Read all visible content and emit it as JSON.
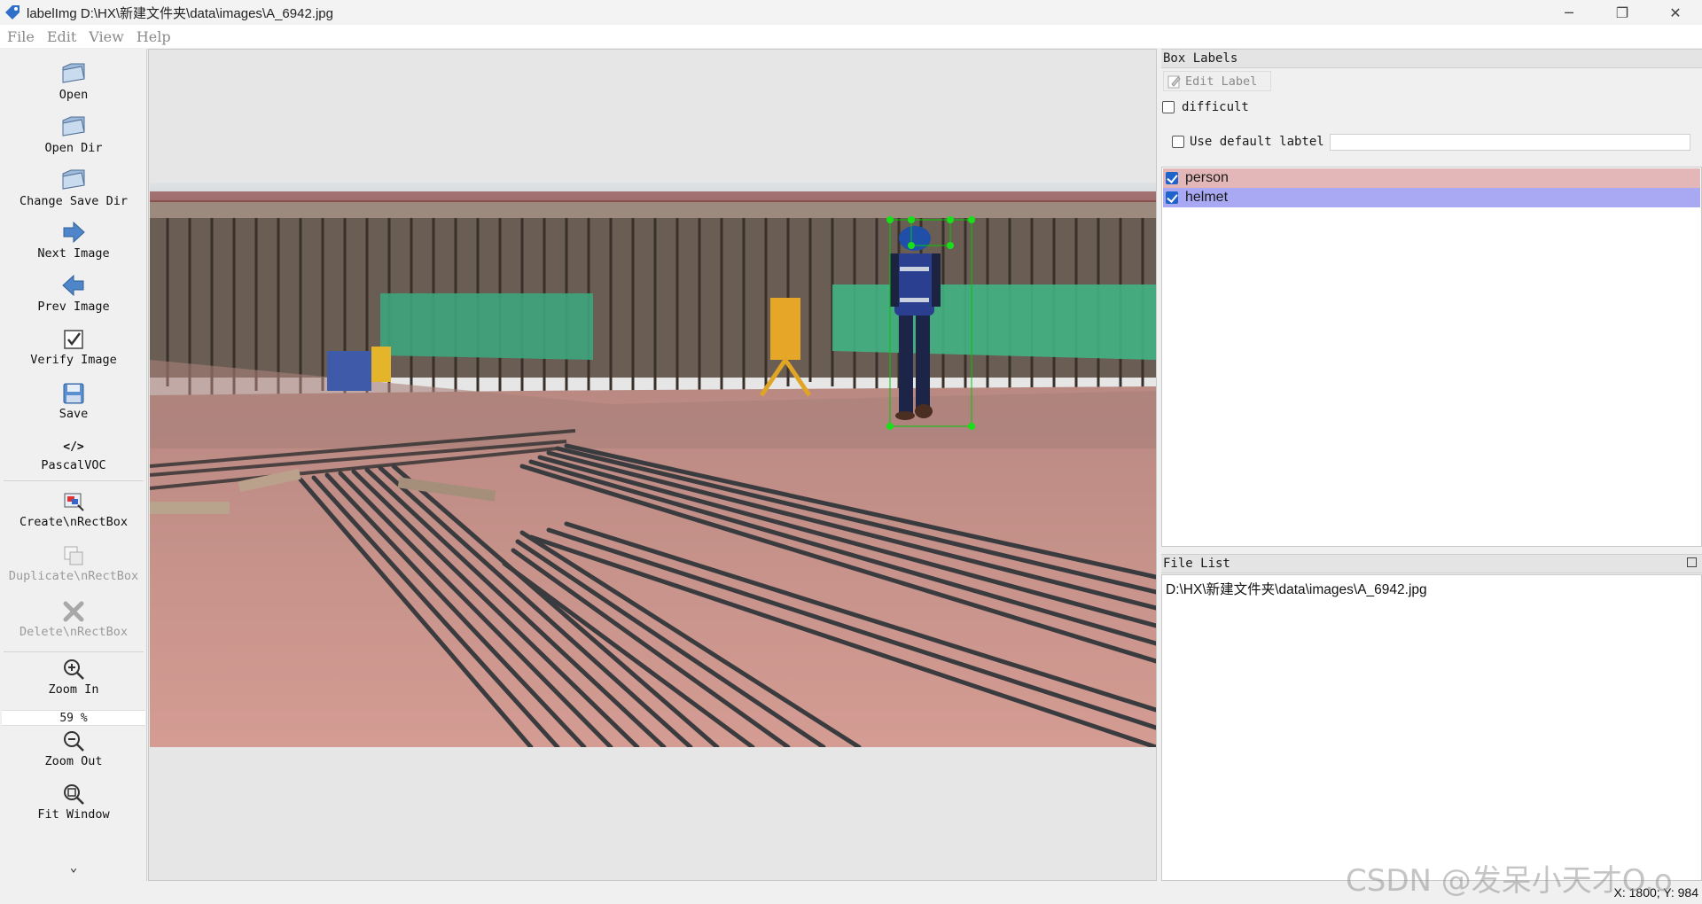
{
  "window": {
    "title": "labelImg D:\\HX\\新建文件夹\\data\\images\\A_6942.jpg",
    "controls": [
      "─",
      "❐",
      "✕"
    ]
  },
  "menu": [
    "File",
    "Edit",
    "View",
    "Help"
  ],
  "toolbar": {
    "open": "Open",
    "open_dir": "Open Dir",
    "change_save_dir": "Change Save Dir",
    "next_image": "Next Image",
    "prev_image": "Prev Image",
    "verify_image": "Verify Image",
    "save": "Save",
    "format": "PascalVOC",
    "format_icon": "</>",
    "create_rectbox": "Create\\nRectBox",
    "duplicate_rectbox": "Duplicate\\nRectBox",
    "delete_rectbox": "Delete\\nRectBox",
    "zoom_in": "Zoom In",
    "zoom_value": "59 %",
    "zoom_out": "Zoom Out",
    "fit_window": "Fit Window",
    "more_icon": "⌄"
  },
  "box_labels": {
    "header": "Box Labels",
    "edit_label": "Edit Label",
    "difficult": "difficult",
    "use_default_label": "Use default labtel",
    "default_label_value": "",
    "labels": [
      {
        "name": "person",
        "checked": true,
        "color": "#e3b7b7"
      },
      {
        "name": "helmet",
        "checked": true,
        "color": "#a9a9f3"
      }
    ]
  },
  "file_list": {
    "header": "File List",
    "files": [
      "D:\\HX\\新建文件夹\\data\\images\\A_6942.jpg"
    ]
  },
  "status": {
    "coords": "X: 1800; Y: 984"
  },
  "watermark": "CSDN @发呆小天才O.o"
}
